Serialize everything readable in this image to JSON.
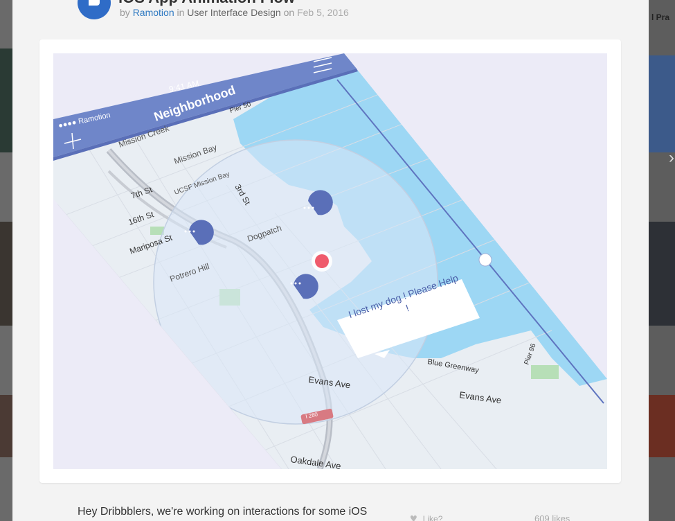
{
  "shot": {
    "title": "iOS App Animation Flow",
    "by_label": "by",
    "author": "Ramotion",
    "in_label": "in",
    "category": "User Interface Design",
    "on_label": "on",
    "date": "Feb 5, 2016"
  },
  "app": {
    "carrier": "●●●● Ramotion",
    "time": "9:41 AM",
    "screen_title": "Neighborhood",
    "help_message": "I lost my dog ! Please Help !",
    "map_labels": {
      "mission_creek": "Mission Creek",
      "mission_bay": "Mission Bay",
      "ucsf": "UCSF Mission Bay",
      "seventh": "7th St",
      "sixteenth": "16th St",
      "third": "3rd St",
      "mariposa": "Mariposa St",
      "dogpatch": "Dogpatch",
      "potrero": "Potrero Hill",
      "pier50": "Pier 50",
      "pier96": "Pier 96",
      "blue_greenway": "Blue Greenway",
      "evans1": "Evans Ave",
      "evans2": "Evans Ave",
      "oakdale": "Oakdale Ave",
      "i280": "I 280"
    }
  },
  "description": "Hey Dribbblers, we're working on interactions for some iOS",
  "like_label": "Like?",
  "likes_count": "609 likes",
  "background": {
    "right_label": "l Pra"
  },
  "colors": {
    "header_bar": "#6f86c9",
    "water": "#9dd7f4",
    "land": "#e9eef3",
    "radius_fill": "#dbe8f7",
    "pin": "#5a6fb8",
    "user_dot": "#ef5b6c",
    "author_link": "#2f7ac2",
    "avatar": "#2f6cc7"
  }
}
